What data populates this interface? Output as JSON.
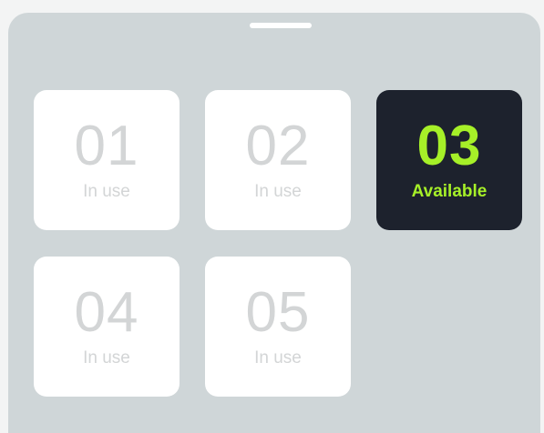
{
  "colors": {
    "sheet_background": "#cfd6d8",
    "tile_background": "#ffffff",
    "tile_in_use_text": "#d3d5d6",
    "tile_available_background": "#1d222d",
    "tile_available_text": "#a6f028"
  },
  "tiles": [
    {
      "number": "01",
      "status": "In use"
    },
    {
      "number": "02",
      "status": "In use"
    },
    {
      "number": "03",
      "status": "Available"
    },
    {
      "number": "04",
      "status": "In use"
    },
    {
      "number": "05",
      "status": "In use"
    }
  ]
}
